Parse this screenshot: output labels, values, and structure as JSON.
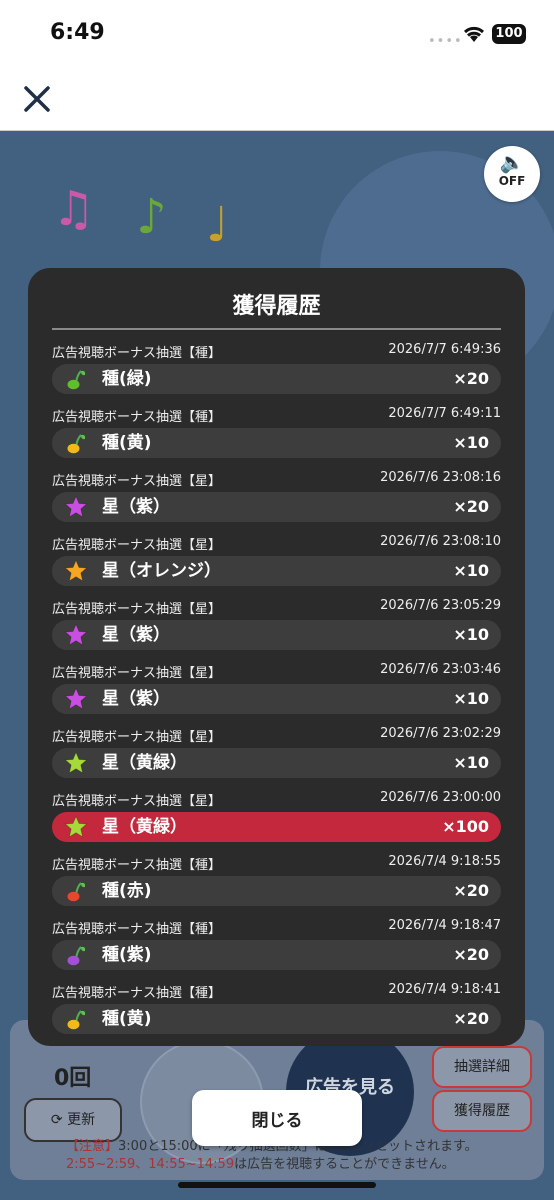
{
  "status": {
    "time": "6:49",
    "battery": "100"
  },
  "sound": {
    "label": "OFF"
  },
  "background": {
    "count": "0回",
    "refresh_label": "更新",
    "ad_label": "広告を見る",
    "details_label": "抽選詳細",
    "history_label": "獲得履歴",
    "notice_head": "【注意】",
    "notice_body": "3:00と15:00に「残り抽選回数」は0回にリセットされます。",
    "notice_times": "2:55~2:59、14:55~14:59",
    "notice_tail": "は広告を視聴することができません。"
  },
  "modal": {
    "title": "獲得履歴",
    "entries": [
      {
        "source": "広告視聴ボーナス抽選【種】",
        "date": "2026/7/7  6:49:36",
        "name": "種(緑)",
        "qty": "×20",
        "icon": "seed-green-icon",
        "color": "#5fbf2a"
      },
      {
        "source": "広告視聴ボーナス抽選【種】",
        "date": "2026/7/7  6:49:11",
        "name": "種(黄)",
        "qty": "×10",
        "icon": "seed-yellow-icon",
        "color": "#f2b81d"
      },
      {
        "source": "広告視聴ボーナス抽選【星】",
        "date": "2026/7/6  23:08:16",
        "name": "星（紫）",
        "qty": "×20",
        "icon": "star-purple-icon",
        "color": "#c94fe0"
      },
      {
        "source": "広告視聴ボーナス抽選【星】",
        "date": "2026/7/6  23:08:10",
        "name": "星（オレンジ）",
        "qty": "×10",
        "icon": "star-orange-icon",
        "color": "#f5a623"
      },
      {
        "source": "広告視聴ボーナス抽選【星】",
        "date": "2026/7/6  23:05:29",
        "name": "星（紫）",
        "qty": "×10",
        "icon": "star-purple-icon",
        "color": "#c94fe0"
      },
      {
        "source": "広告視聴ボーナス抽選【星】",
        "date": "2026/7/6  23:03:46",
        "name": "星（紫）",
        "qty": "×10",
        "icon": "star-purple-icon",
        "color": "#c94fe0"
      },
      {
        "source": "広告視聴ボーナス抽選【星】",
        "date": "2026/7/6  23:02:29",
        "name": "星（黄緑）",
        "qty": "×10",
        "icon": "star-yellowgreen-icon",
        "color": "#a6d93a"
      },
      {
        "source": "広告視聴ボーナス抽選【星】",
        "date": "2026/7/6  23:00:00",
        "name": "星（黄緑）",
        "qty": "×100",
        "icon": "star-yellowgreen-icon",
        "color": "#a6d93a",
        "highlight": true
      },
      {
        "source": "広告視聴ボーナス抽選【種】",
        "date": "2026/7/4  9:18:55",
        "name": "種(赤)",
        "qty": "×20",
        "icon": "seed-red-icon",
        "color": "#e5482a"
      },
      {
        "source": "広告視聴ボーナス抽選【種】",
        "date": "2026/7/4  9:18:47",
        "name": "種(紫)",
        "qty": "×20",
        "icon": "seed-purple-icon",
        "color": "#a34fd6"
      },
      {
        "source": "広告視聴ボーナス抽選【種】",
        "date": "2026/7/4  9:18:41",
        "name": "種(黄)",
        "qty": "×20",
        "icon": "seed-yellow-icon",
        "color": "#f2b81d"
      }
    ],
    "close_label": "閉じる"
  }
}
